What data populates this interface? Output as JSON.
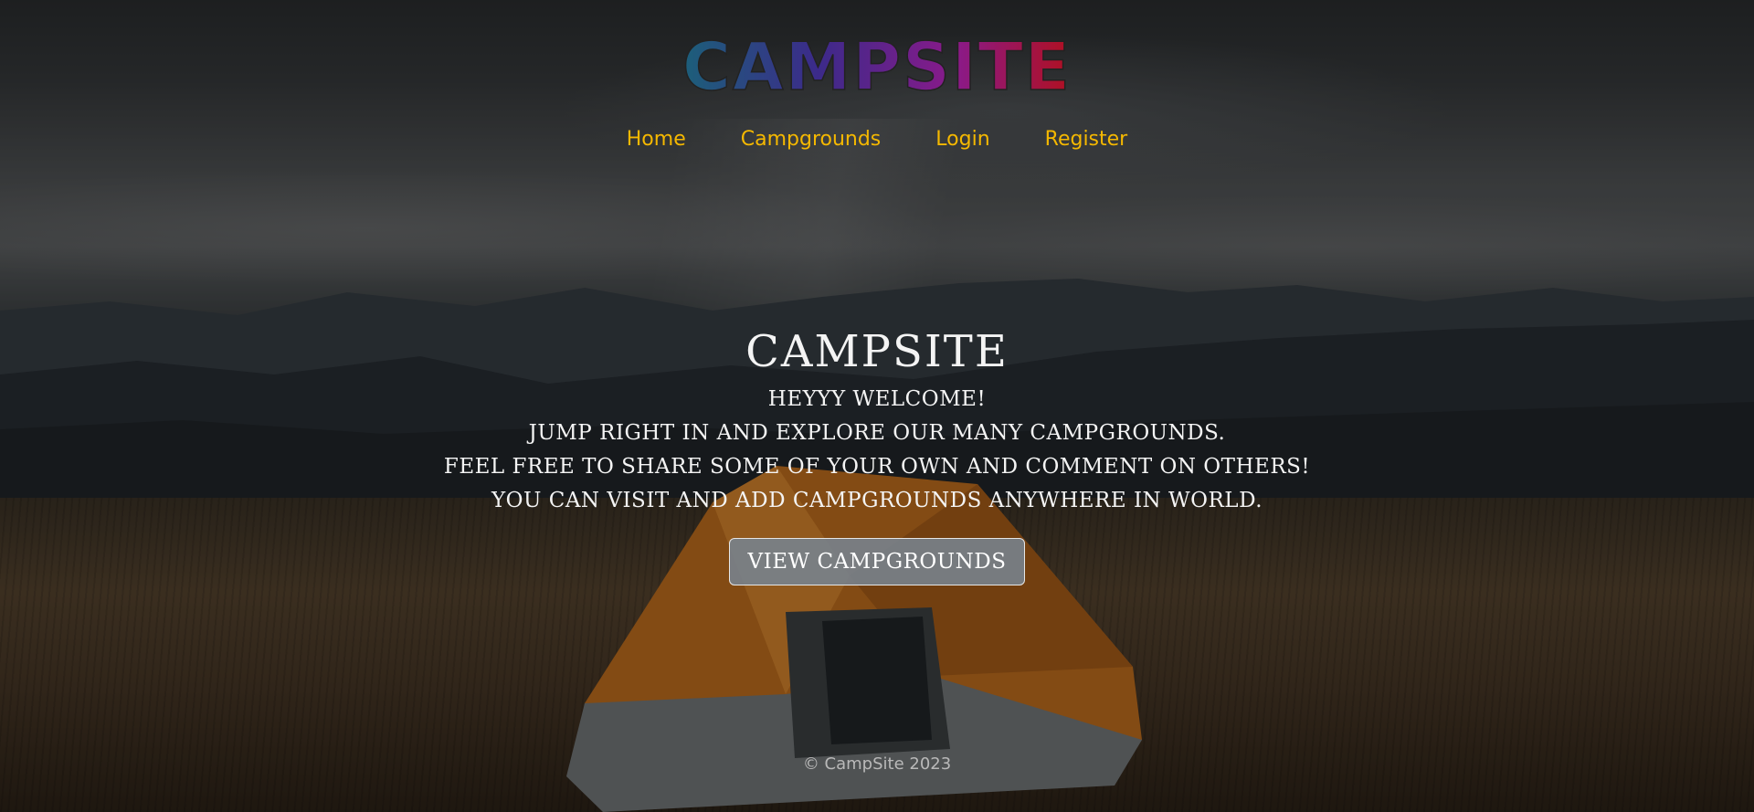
{
  "brand": {
    "logo_text": "CAMPSITE"
  },
  "nav": {
    "items": [
      {
        "label": "Home"
      },
      {
        "label": "Campgrounds"
      },
      {
        "label": "Login"
      },
      {
        "label": "Register"
      }
    ]
  },
  "hero": {
    "title": "CAMPSITE",
    "lines": [
      "HEYYY WELCOME!",
      "JUMP RIGHT IN AND EXPLORE OUR MANY CAMPGROUNDS.",
      "FEEL FREE TO SHARE SOME OF YOUR OWN AND COMMENT ON OTHERS!",
      "YOU CAN VISIT AND ADD CAMPGROUNDS ANYWHERE IN WORLD."
    ],
    "cta_label": "VIEW CAMPGROUNDS"
  },
  "footer": {
    "copyright": "© CampSite 2023"
  },
  "colors": {
    "nav_link": "#f5b800",
    "hero_text": "#f4f4f4",
    "button_bg": "#78828c",
    "logo_gradient": [
      "#1c5f7a",
      "#3c2a8a",
      "#8a1a8a",
      "#b01020"
    ]
  }
}
